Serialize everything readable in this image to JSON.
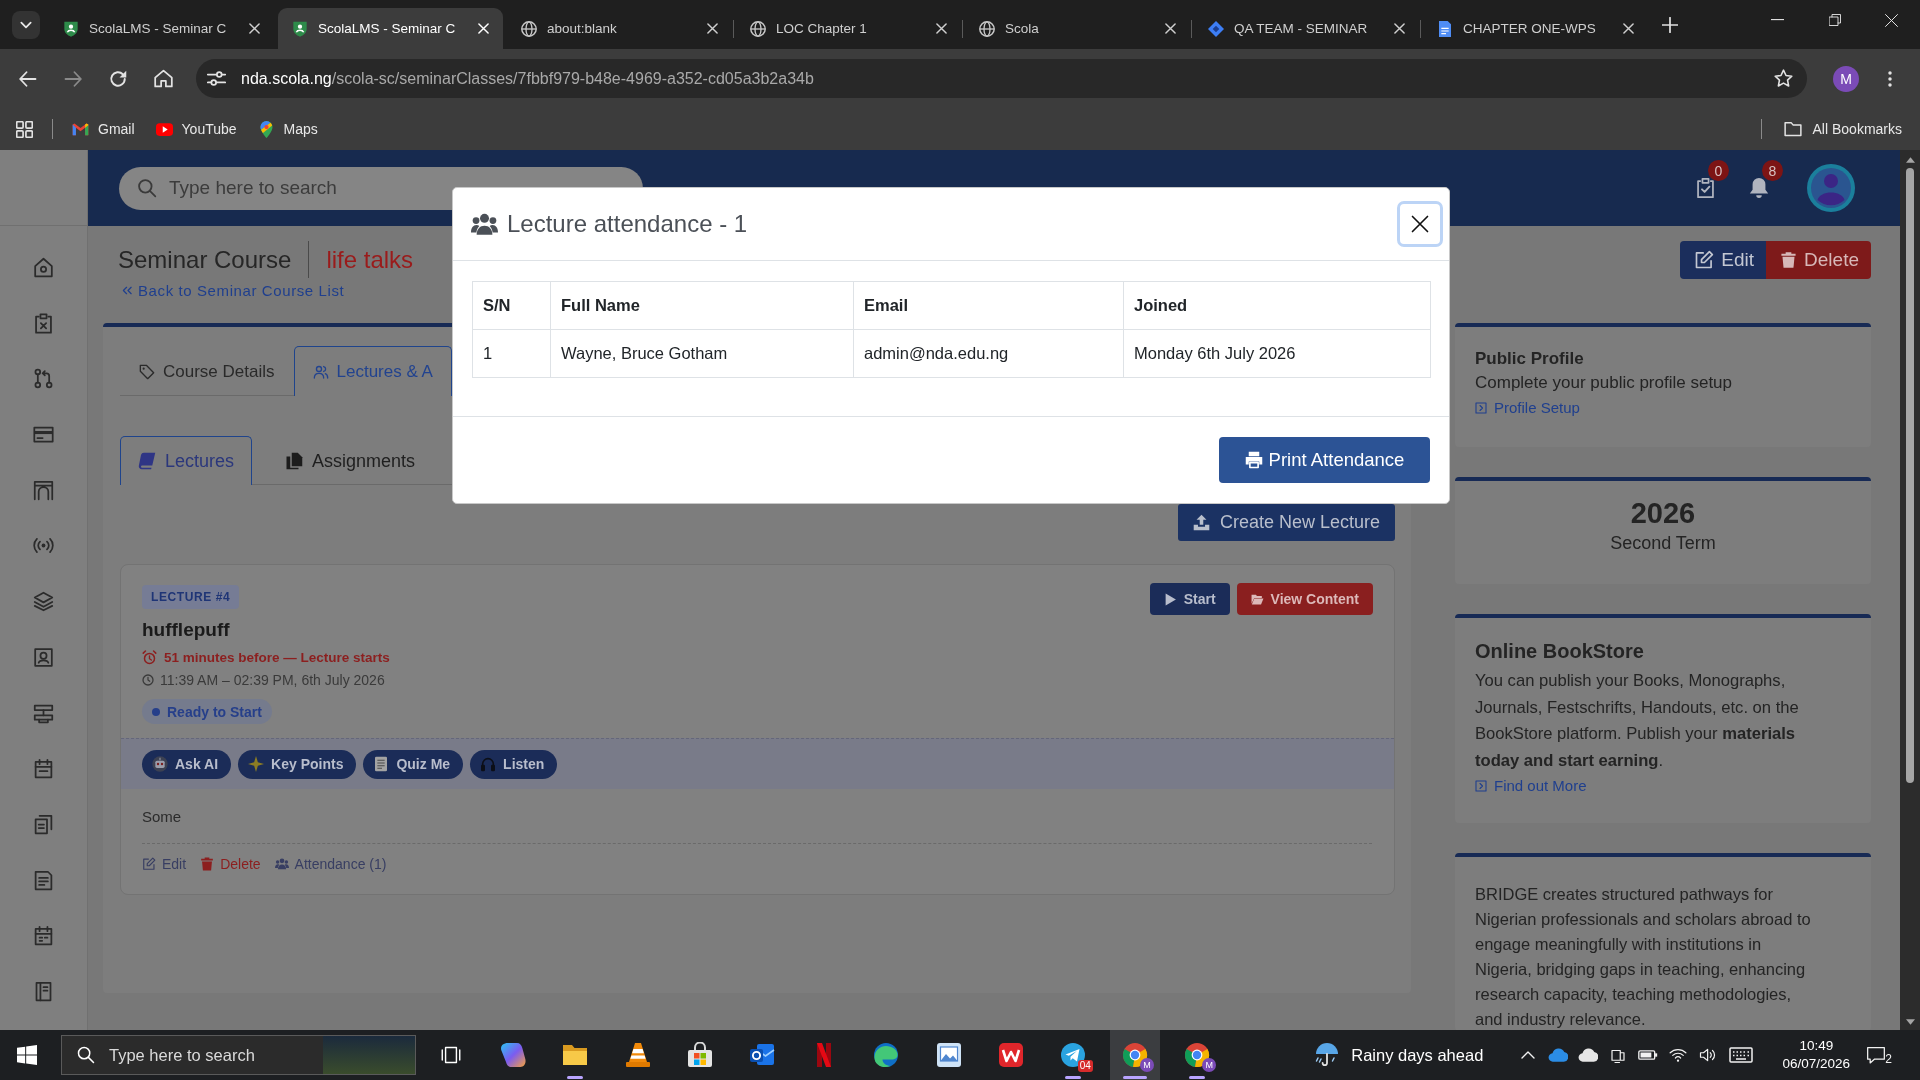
{
  "browser": {
    "tabs": [
      {
        "kind": "crest",
        "title": "ScolaLMS - Seminar C",
        "selected": false
      },
      {
        "kind": "crest",
        "title": "ScolaLMS - Seminar C",
        "selected": true
      },
      {
        "kind": "globe",
        "title": "about:blank",
        "selected": false
      },
      {
        "kind": "globe",
        "title": "LOC Chapter 1",
        "selected": false
      },
      {
        "kind": "globe",
        "title": "Scola",
        "selected": false
      },
      {
        "kind": "diamond",
        "title": "QA TEAM - SEMINAR",
        "selected": false
      },
      {
        "kind": "document",
        "title": "CHAPTER ONE-WPS",
        "selected": false
      }
    ],
    "address": {
      "host": "nda.scola.ng",
      "path": "/scola-sc/seminarClasses/7fbbf979-b48e-4969-a352-cd05a3b2a34b"
    },
    "profile_initial": "M",
    "bookmarks": [
      {
        "kind": "mail",
        "label": "Gmail"
      },
      {
        "kind": "video",
        "label": "YouTube"
      },
      {
        "kind": "pin",
        "label": "Maps"
      }
    ],
    "all_bookmarks": "All Bookmarks"
  },
  "topbar": {
    "search_placeholder": "Type here to search",
    "badges": [
      {
        "kind": "tasks",
        "count": "0"
      },
      {
        "kind": "alerts",
        "count": "8"
      }
    ]
  },
  "header": {
    "title": "Seminar Course",
    "course": "life talks",
    "back_link": "Back to Seminar Course List",
    "buttons": [
      {
        "kind": "edit",
        "label": "Edit"
      },
      {
        "kind": "delete",
        "label": "Delete"
      }
    ]
  },
  "tabs": [
    {
      "kind": "details",
      "label": "Course Details",
      "selected": false
    },
    {
      "kind": "lectures",
      "label": "Lectures & A",
      "selected": true
    }
  ],
  "subtabs": [
    {
      "kind": "lectures",
      "label": "Lectures",
      "selected": true
    },
    {
      "kind": "assignments",
      "label": "Assignments",
      "selected": false
    }
  ],
  "create_button": "Create New Lecture",
  "lecture": {
    "badge": "LECTURE #4",
    "title": "hufflepuff",
    "countdown": "51 minutes before — Lecture starts",
    "schedule": "11:39 AM – 02:39 PM, 6th July 2026",
    "status": "Ready to Start",
    "actions": [
      {
        "kind": "start",
        "label": "Start"
      },
      {
        "kind": "view",
        "label": "View Content"
      }
    ],
    "tools": [
      {
        "kind": "robot",
        "label": "Ask AI"
      },
      {
        "kind": "sparkle",
        "label": "Key Points"
      },
      {
        "kind": "memo",
        "label": "Quiz Me"
      },
      {
        "kind": "headphones",
        "label": "Listen"
      }
    ],
    "description": "Some",
    "links": [
      {
        "kind": "edit",
        "label": "Edit"
      },
      {
        "kind": "delete",
        "label": "Delete"
      },
      {
        "kind": "attendance",
        "label": "Attendance (1)"
      }
    ]
  },
  "side_cards": [
    {
      "kind": "profile",
      "title": "Public Profile",
      "text": "Complete your public profile setup",
      "link": "Profile Setup"
    },
    {
      "kind": "term",
      "year": "2026",
      "term": "Second Term"
    },
    {
      "kind": "info",
      "title": "Online BookStore",
      "text": "You can publish your Books, Monographs, Journals, Festschrifts, Handouts, etc. on the BookStore platform. Publish your **materials today and start earning**.",
      "link": "Find out More"
    },
    {
      "kind": "about",
      "text": "BRIDGE creates structured pathways for Nigerian professionals and scholars abroad to engage meaningfully with institutions in Nigeria, bridging gaps in teaching, enhancing research capacity, teaching methodologies, and industry relevance."
    }
  ],
  "modal": {
    "title": "Lecture attendance - 1",
    "columns": [
      "S/N",
      "Full Name",
      "Email",
      "Joined"
    ],
    "rows": [
      [
        "1",
        "Wayne, Bruce Gotham",
        "admin@nda.edu.ng",
        "Monday 6th July 2026"
      ]
    ],
    "print_button": "Print Attendance"
  },
  "taskbar": {
    "search_placeholder": "Type here to search",
    "apps": [
      {
        "kind": "swirl",
        "running": false,
        "selected": false
      },
      {
        "kind": "folder",
        "running": true,
        "selected": false
      },
      {
        "kind": "cone",
        "running": false,
        "selected": false
      },
      {
        "kind": "bag",
        "running": false,
        "selected": false
      },
      {
        "kind": "mail",
        "running": false,
        "selected": false
      },
      {
        "kind": "ribbon",
        "running": false,
        "selected": false
      },
      {
        "kind": "wave",
        "running": false,
        "selected": false
      },
      {
        "kind": "picture",
        "running": false,
        "selected": false
      },
      {
        "kind": "zigzag",
        "running": false,
        "selected": false
      },
      {
        "kind": "plane",
        "running": true,
        "selected": false,
        "count": "04"
      },
      {
        "kind": "browser",
        "running": true,
        "selected": true,
        "profile": "M"
      },
      {
        "kind": "browser",
        "running": true,
        "selected": false,
        "profile": "M"
      }
    ],
    "weather": "Rainy days ahead",
    "time": "10:49",
    "date": "06/07/2026",
    "notifications": "2"
  }
}
